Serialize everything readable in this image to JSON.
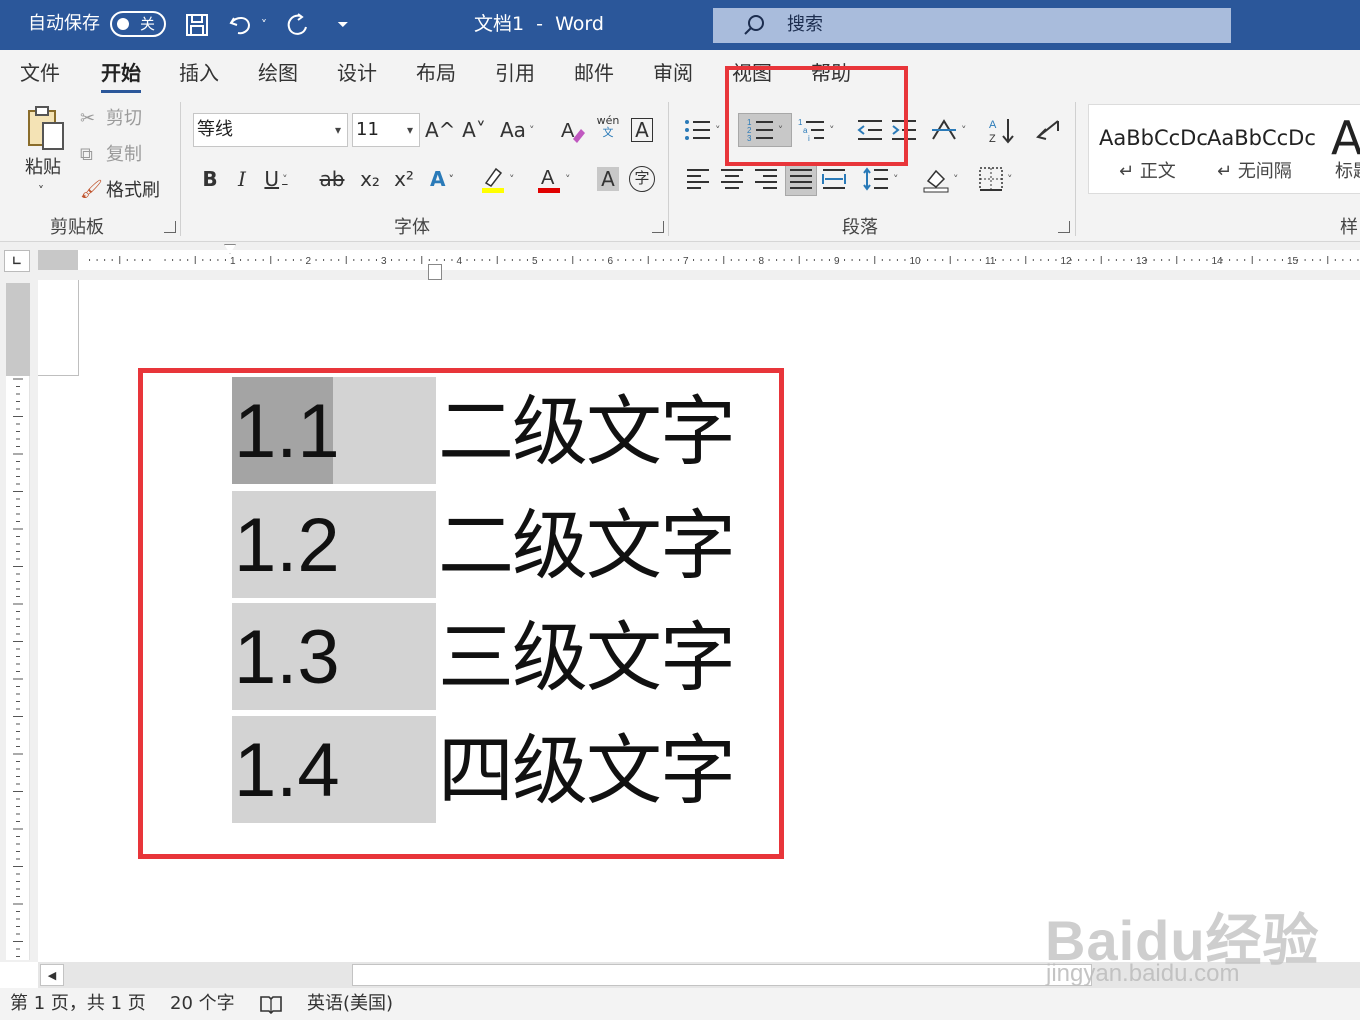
{
  "titlebar": {
    "autosave_label": "自动保存",
    "autosave_toggle": "关",
    "doc_title": "文档1  -  Word",
    "search_placeholder": "搜索"
  },
  "tabs": [
    "文件",
    "开始",
    "插入",
    "绘图",
    "设计",
    "布局",
    "引用",
    "邮件",
    "审阅",
    "视图",
    "帮助"
  ],
  "active_tab": "开始",
  "clipboard": {
    "paste": "粘贴",
    "cut": "剪切",
    "copy": "复制",
    "format_painter": "格式刷",
    "group_label": "剪贴板"
  },
  "font": {
    "name": "等线",
    "size": "11",
    "group_label": "字体",
    "grow": "A^",
    "shrink": "A˅",
    "change_case": "Aa",
    "phonetic": "wén",
    "phonetic_sub": "文",
    "bold": "B",
    "italic": "I",
    "underline": "U",
    "strike": "ab",
    "subscript": "x₂",
    "superscript": "x²",
    "effects": "A",
    "font_color": "A",
    "char_shading": "A",
    "enclose": "字"
  },
  "paragraph": {
    "group_label": "段落"
  },
  "styles": {
    "items": [
      {
        "sample": "AaBbCcDc",
        "name": "正文"
      },
      {
        "sample": "AaBbCcDc",
        "name": "无间隔"
      },
      {
        "sample": "Aa",
        "name": "标题"
      }
    ],
    "group_label": "样"
  },
  "document": {
    "list": [
      {
        "number": "1.1",
        "text": "二级文字"
      },
      {
        "number": "1.2",
        "text": "二级文字"
      },
      {
        "number": "1.3",
        "text": "三级文字"
      },
      {
        "number": "1.4",
        "text": "四级文字"
      }
    ]
  },
  "statusbar": {
    "page": "第 1 页，共 1 页",
    "words": "20 个字",
    "language": "英语(美国)"
  },
  "watermark": {
    "logo": "Baidu经验",
    "url": "jingyan.baidu.com"
  },
  "colors": {
    "titlebar": "#2b579a",
    "highlight": "#e8353a",
    "ribbon": "#f3f3f3"
  }
}
